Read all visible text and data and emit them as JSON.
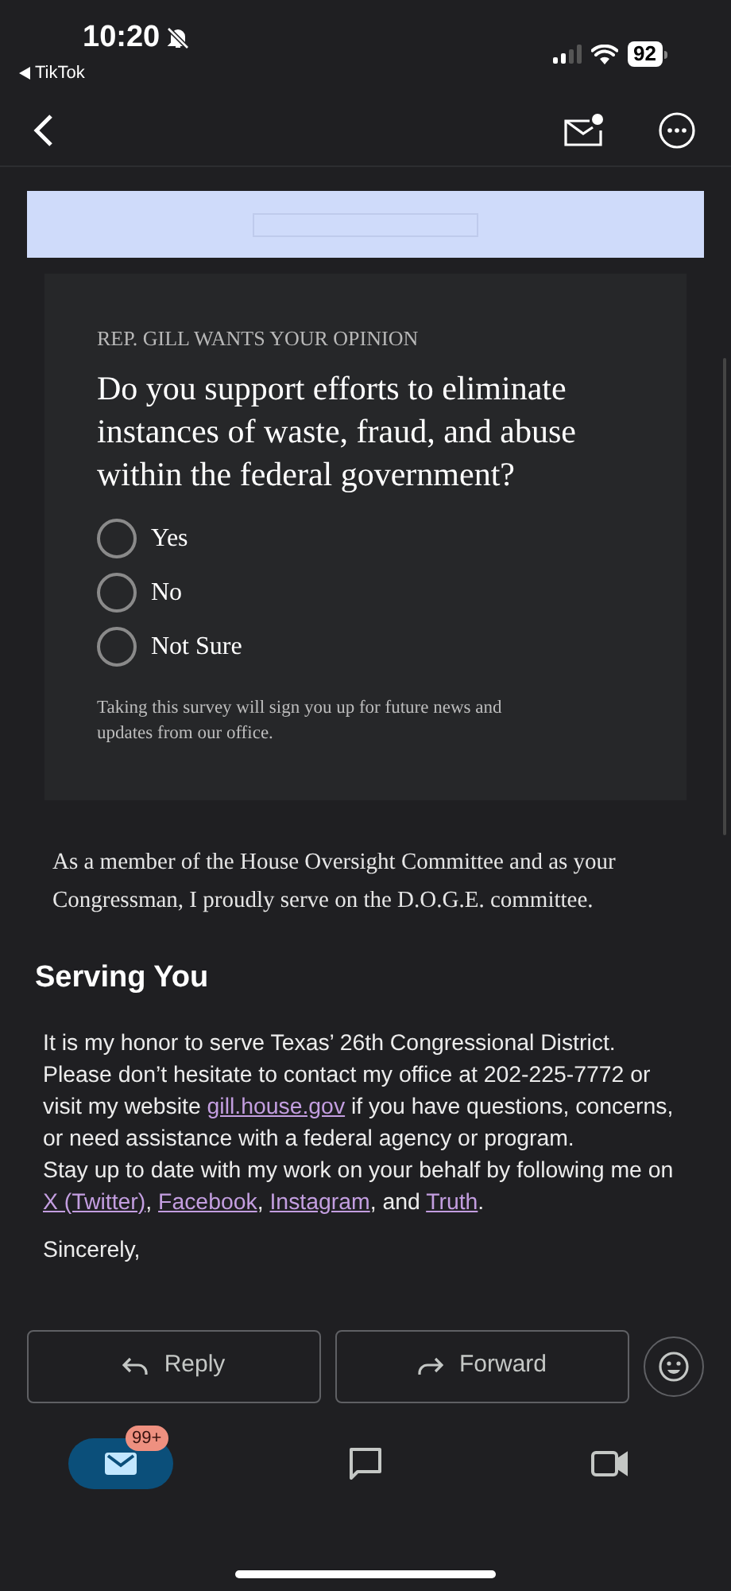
{
  "status_bar": {
    "time": "10:20",
    "back_app": "TikTok",
    "battery": "92"
  },
  "survey": {
    "eyebrow": "REP. GILL WANTS YOUR OPINION",
    "question": "Do you support efforts to eliminate instances of waste, fraud, and abuse within the federal government?",
    "options": [
      {
        "label": "Yes",
        "selected": false
      },
      {
        "label": "No",
        "selected": false
      },
      {
        "label": "Not Sure",
        "selected": false
      }
    ],
    "disclaimer": "Taking this survey will sign you up for future news and updates from our office."
  },
  "intro": "As a member of the House Oversight Committee and as your Congressman, I proudly serve on the D.O.G.E. committee.",
  "section": {
    "heading": "Serving You",
    "paragraphs": [
      [
        {
          "kind": "text",
          "text": "It is my honor to serve Texas’ 26th Congressional District. Please don’t hesitate to contact my office at 202-225-7772 or visit my website "
        },
        {
          "kind": "link",
          "text": "gill.house.gov"
        },
        {
          "kind": "text",
          "text": " if you have questions, concerns, or need assistance with a federal agency or program."
        }
      ],
      [
        {
          "kind": "text",
          "text": "Stay up to date with my work on your behalf by following me on "
        },
        {
          "kind": "link",
          "text": "X (Twitter)"
        },
        {
          "kind": "text",
          "text": ", "
        },
        {
          "kind": "link",
          "text": "Facebook"
        },
        {
          "kind": "text",
          "text": ", "
        },
        {
          "kind": "link",
          "text": "Instagram"
        },
        {
          "kind": "text",
          "text": ", and "
        },
        {
          "kind": "link",
          "text": "Truth"
        },
        {
          "kind": "text",
          "text": "."
        }
      ]
    ],
    "closing": "Sincerely,"
  },
  "actions": [
    {
      "kind": "reply",
      "label": "Reply"
    },
    {
      "kind": "forward",
      "label": "Forward"
    }
  ],
  "bottom_nav": [
    {
      "kind": "mail",
      "selected": true,
      "badge": "99+"
    },
    {
      "kind": "chat",
      "selected": false
    },
    {
      "kind": "video",
      "selected": false
    }
  ]
}
